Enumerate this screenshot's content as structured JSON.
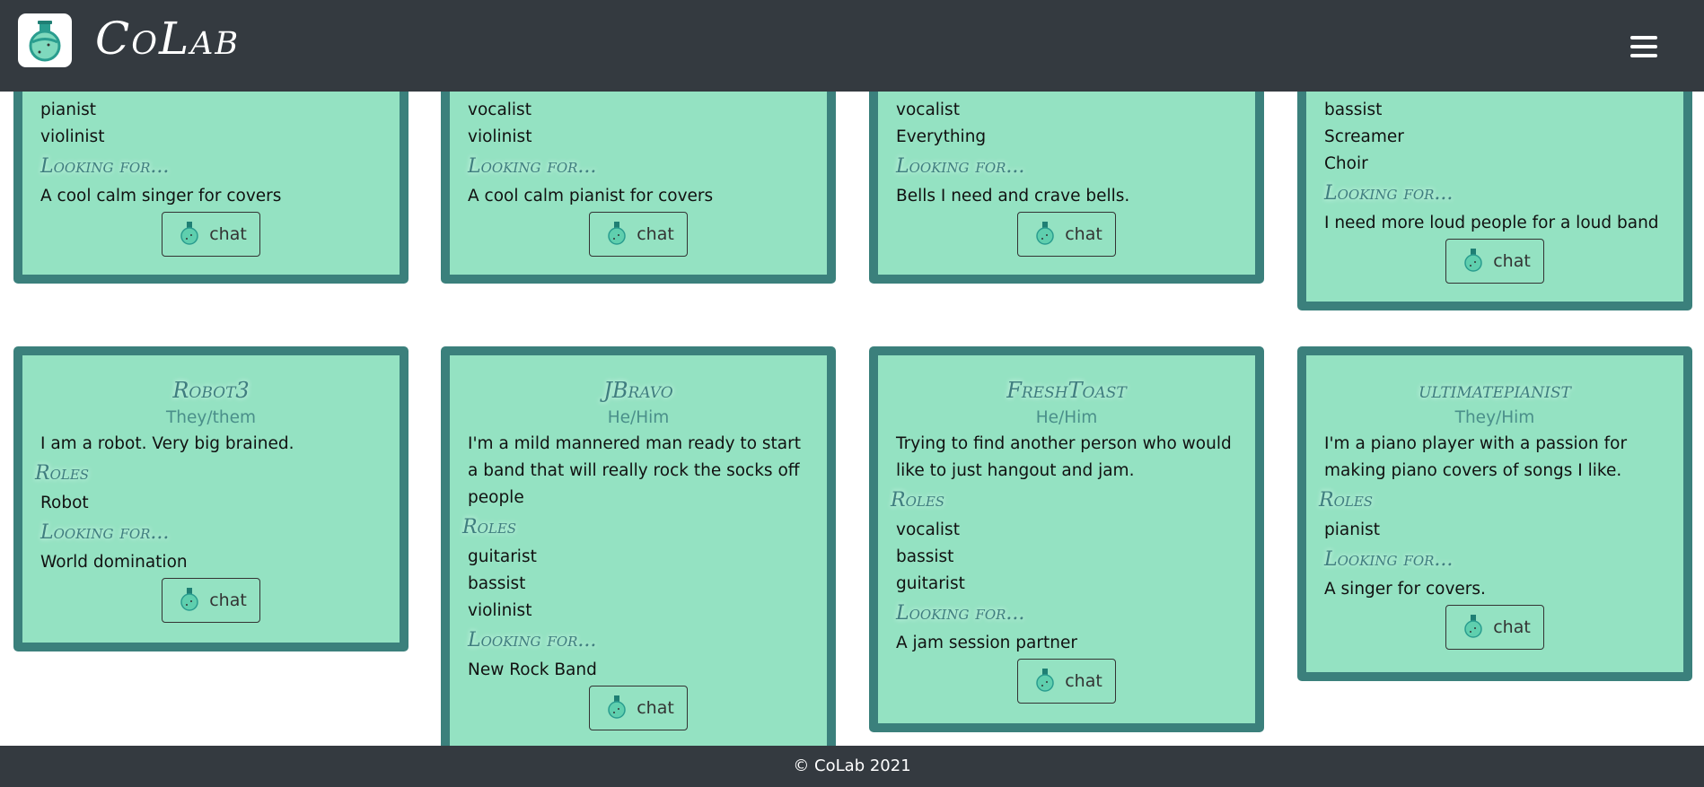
{
  "header": {
    "brand": "CoLab",
    "menu_icon": "hamburger-icon",
    "logo_icon": "flask-icon"
  },
  "colors": {
    "header_bg": "#343a40",
    "card_bg": "#94e2c2",
    "card_border": "#3b807c",
    "heading": "#3f7d7f"
  },
  "labels": {
    "roles": "Roles",
    "looking_for": "Looking for...",
    "chat": "chat"
  },
  "top_row": [
    {
      "roles": [
        "pianist",
        "violinist"
      ],
      "looking_for": "A cool calm singer for covers"
    },
    {
      "roles": [
        "vocalist",
        "violinist"
      ],
      "looking_for": "A cool calm pianist for covers"
    },
    {
      "roles": [
        "vocalist",
        "Everything"
      ],
      "looking_for": "Bells I need and crave bells."
    },
    {
      "roles": [
        "bassist",
        "Screamer",
        "Choir"
      ],
      "looking_for": "I need more loud people for a loud band"
    }
  ],
  "bottom_row": [
    {
      "name": "Robot3",
      "pronouns": "They/them",
      "bio": "I am a robot. Very big brained.",
      "roles": [
        "Robot"
      ],
      "looking_for": "World domination"
    },
    {
      "name": "JBravo",
      "pronouns": "He/Him",
      "bio": "I'm a mild mannered man ready to start a band that will really rock the socks off people",
      "roles": [
        "guitarist",
        "bassist",
        "violinist"
      ],
      "looking_for": "New Rock Band"
    },
    {
      "name": "FreshToast",
      "pronouns": "He/Him",
      "bio": "Trying to find another person who would like to just hangout and jam.",
      "roles": [
        "vocalist",
        "bassist",
        "guitarist"
      ],
      "looking_for": "A jam session partner"
    },
    {
      "name": "ultimatepianist",
      "pronouns": "They/Him",
      "bio": "I'm a piano player with a passion for making piano covers of songs I like.",
      "roles": [
        "pianist"
      ],
      "looking_for": "A singer for covers."
    }
  ],
  "footer": {
    "text": "© CoLab 2021"
  }
}
